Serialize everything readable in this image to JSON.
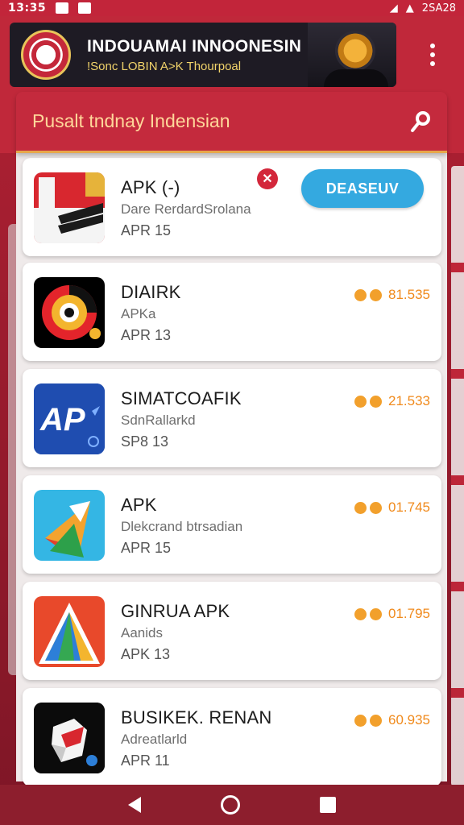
{
  "status_bar": {
    "time": "13:35",
    "right_text": "2SA28"
  },
  "banner": {
    "title": "INDOUAMAI INNOONESIN",
    "subtitle": "!Sonc LOBIN A>K Thourpoal"
  },
  "search": {
    "placeholder": "Pusalt tndnay Indensian"
  },
  "apps": [
    {
      "name": "APK (-)",
      "subtitle": "Dare RerdardSrolana",
      "date": "APR 15",
      "action": "DEASEUV",
      "has_close": true,
      "icon": "flag-folder-icon"
    },
    {
      "name": "DIAIRK",
      "subtitle": "APKa",
      "date": "APR 13",
      "rating": "81.535",
      "icon": "wheel-icon"
    },
    {
      "name": "SIMATCOAFIK",
      "subtitle": "SdnRallarkd",
      "date": "SP8 13",
      "rating": "21.533",
      "icon": "ap-logo-icon"
    },
    {
      "name": "APK",
      "subtitle": "Dlekcrand btrsadian",
      "date": "APR 15",
      "rating": "01.745",
      "icon": "paper-plane-icon"
    },
    {
      "name": "GINRUA APK",
      "subtitle": "Aanids",
      "date": "APK 13",
      "rating": "01.795",
      "icon": "triangle-logo-icon"
    },
    {
      "name": "BUSIKEK. RENAN",
      "subtitle": "Adreatlarld",
      "date": "APR 11",
      "rating": "60.935",
      "icon": "cube-icon"
    }
  ],
  "colors": {
    "primary": "#c0283a",
    "accent": "#34a9e0",
    "rating": "#f08a1c"
  }
}
